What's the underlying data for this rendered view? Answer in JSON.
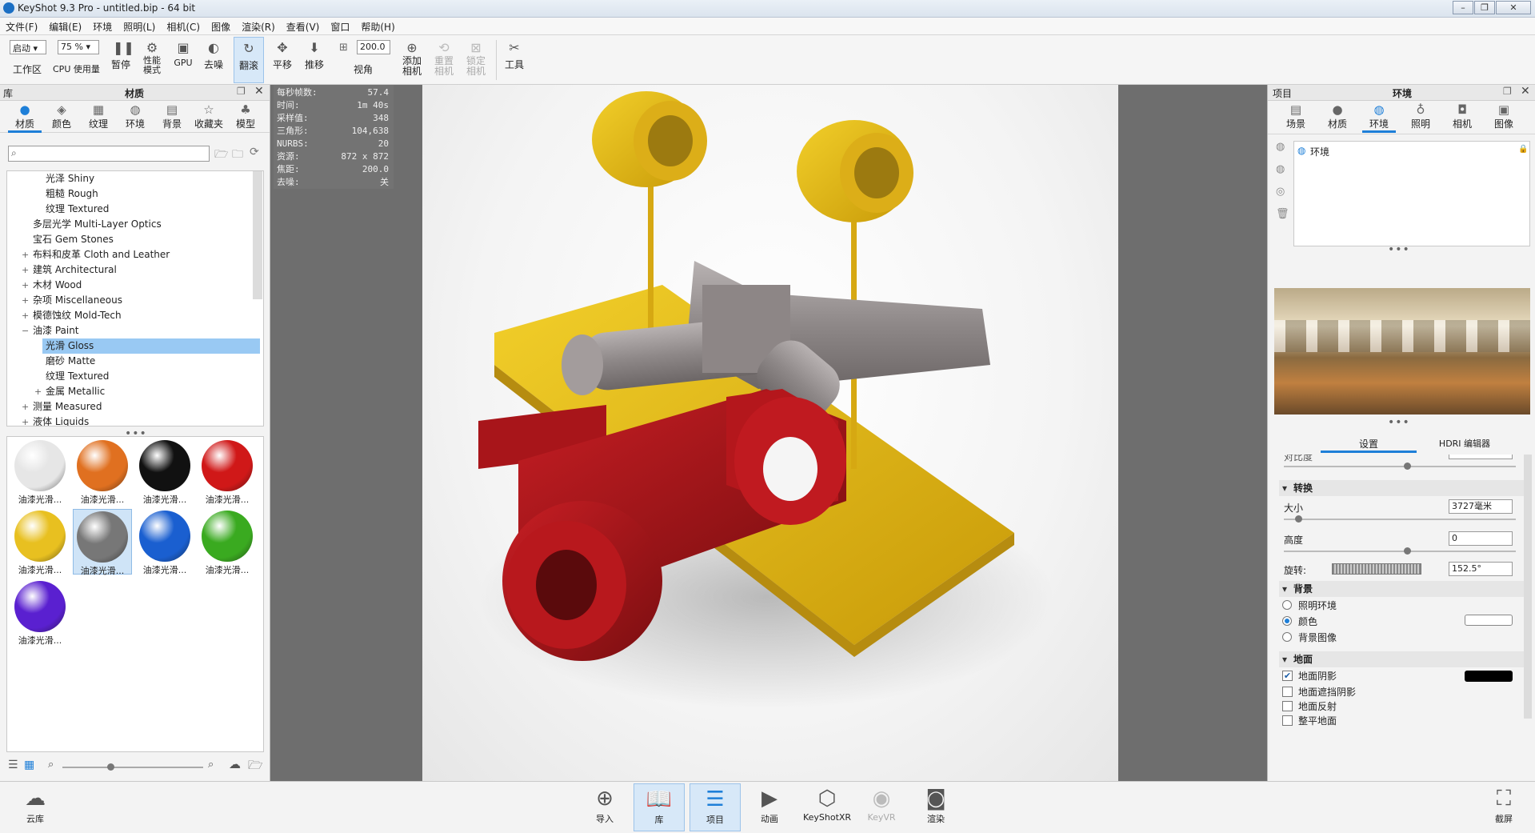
{
  "window": {
    "title": "KeyShot 9.3 Pro  - untitled.bip  - 64 bit"
  },
  "menu": [
    "文件(F)",
    "编辑(E)",
    "环境",
    "照明(L)",
    "相机(C)",
    "图像",
    "渲染(R)",
    "查看(V)",
    "窗口",
    "帮助(H)"
  ],
  "toolbar": {
    "workspace_value": "启动",
    "workspace_label": "工作区",
    "cpu_value": "75 %",
    "cpu_label": "CPU 使用量",
    "pause": "暂停",
    "perf_mode": "性能\n模式",
    "gpu": "GPU",
    "denoise": "去噪",
    "tumble": "翻滚",
    "pan": "平移",
    "dolly": "推移",
    "fov_value": "200.0",
    "fov_label": "视角",
    "add_camera": "添加\n相机",
    "reset_camera": "重置\n相机",
    "lock_camera": "锁定\n相机",
    "tools": "工具"
  },
  "library": {
    "header_left": "库",
    "header_title": "材质",
    "tabs": [
      "材质",
      "颜色",
      "纹理",
      "环境",
      "背景",
      "收藏夹",
      "模型"
    ],
    "search_placeholder": "",
    "tree": [
      {
        "label": "光泽 Shiny",
        "indent": 3,
        "pm": ""
      },
      {
        "label": "粗糙 Rough",
        "indent": 3,
        "pm": ""
      },
      {
        "label": "纹理 Textured",
        "indent": 3,
        "pm": ""
      },
      {
        "label": "多层光学 Multi-Layer Optics",
        "indent": 2,
        "pm": ""
      },
      {
        "label": "宝石 Gem Stones",
        "indent": 2,
        "pm": ""
      },
      {
        "label": "布料和皮革 Cloth and Leather",
        "indent": 2,
        "pm": "+"
      },
      {
        "label": "建筑 Architectural",
        "indent": 2,
        "pm": "+"
      },
      {
        "label": "木材 Wood",
        "indent": 2,
        "pm": "+"
      },
      {
        "label": "杂项 Miscellaneous",
        "indent": 2,
        "pm": "+"
      },
      {
        "label": "模德蚀纹 Mold-Tech",
        "indent": 2,
        "pm": "+"
      },
      {
        "label": "油漆 Paint",
        "indent": 2,
        "pm": "−"
      },
      {
        "label": "光滑 Gloss",
        "indent": 3,
        "pm": "",
        "selected": true
      },
      {
        "label": "磨砂 Matte",
        "indent": 3,
        "pm": ""
      },
      {
        "label": "纹理 Textured",
        "indent": 3,
        "pm": ""
      },
      {
        "label": "金属 Metallic",
        "indent": 3,
        "pm": "+"
      },
      {
        "label": "测量 Measured",
        "indent": 2,
        "pm": "+"
      },
      {
        "label": "液体 Liquids",
        "indent": 2,
        "pm": "+"
      }
    ],
    "thumbnails": [
      {
        "label": "油漆光滑...",
        "color": "#e6e6e6"
      },
      {
        "label": "油漆光滑...",
        "color": "#e07020"
      },
      {
        "label": "油漆光滑...",
        "color": "#111111"
      },
      {
        "label": "油漆光滑...",
        "color": "#d01818"
      },
      {
        "label": "油漆光滑...",
        "color": "#e8c020"
      },
      {
        "label": "油漆光滑...",
        "color": "#777777",
        "selected": true
      },
      {
        "label": "油漆光滑...",
        "color": "#1a5fd0"
      },
      {
        "label": "油漆光滑...",
        "color": "#3aaa20"
      },
      {
        "label": "油漆光滑...",
        "color": "#5a20d0"
      }
    ]
  },
  "stats": [
    {
      "k": "每秒帧数:",
      "v": "57.4"
    },
    {
      "k": "时间:",
      "v": "1m 40s"
    },
    {
      "k": "采样值:",
      "v": "348"
    },
    {
      "k": "三角形:",
      "v": "104,638"
    },
    {
      "k": "NURBS:",
      "v": "20"
    },
    {
      "k": "资源:",
      "v": "872 x 872"
    },
    {
      "k": "焦距:",
      "v": "200.0"
    },
    {
      "k": "去噪:",
      "v": "关"
    }
  ],
  "project": {
    "header_left": "项目",
    "header_title": "环境",
    "tabs": [
      "场景",
      "材质",
      "环境",
      "照明",
      "相机",
      "图像"
    ],
    "env_item": "环境",
    "subtabs": [
      "设置",
      "HDRI 编辑器"
    ],
    "cut_label": "对比度",
    "transform": {
      "title": "转换",
      "size_label": "大小",
      "size_value": "3727毫米",
      "height_label": "高度",
      "height_value": "0",
      "rotate_label": "旋转:",
      "rotate_value": "152.5°"
    },
    "background": {
      "title": "背景",
      "options": [
        "照明环境",
        "颜色",
        "背景图像"
      ],
      "selected": 1
    },
    "ground": {
      "title": "地面",
      "options": [
        "地面阴影",
        "地面遮挡阴影",
        "地面反射",
        "整平地面"
      ],
      "checked": [
        true,
        false,
        false,
        false
      ]
    }
  },
  "bottom": {
    "cloud": "云库",
    "buttons": [
      "导入",
      "库",
      "项目",
      "动画",
      "KeyShotXR",
      "KeyVR",
      "渲染"
    ],
    "screenshot": "截屏"
  },
  "colors": {
    "accent": "#1e7fd8",
    "selection": "#99c9f3"
  }
}
